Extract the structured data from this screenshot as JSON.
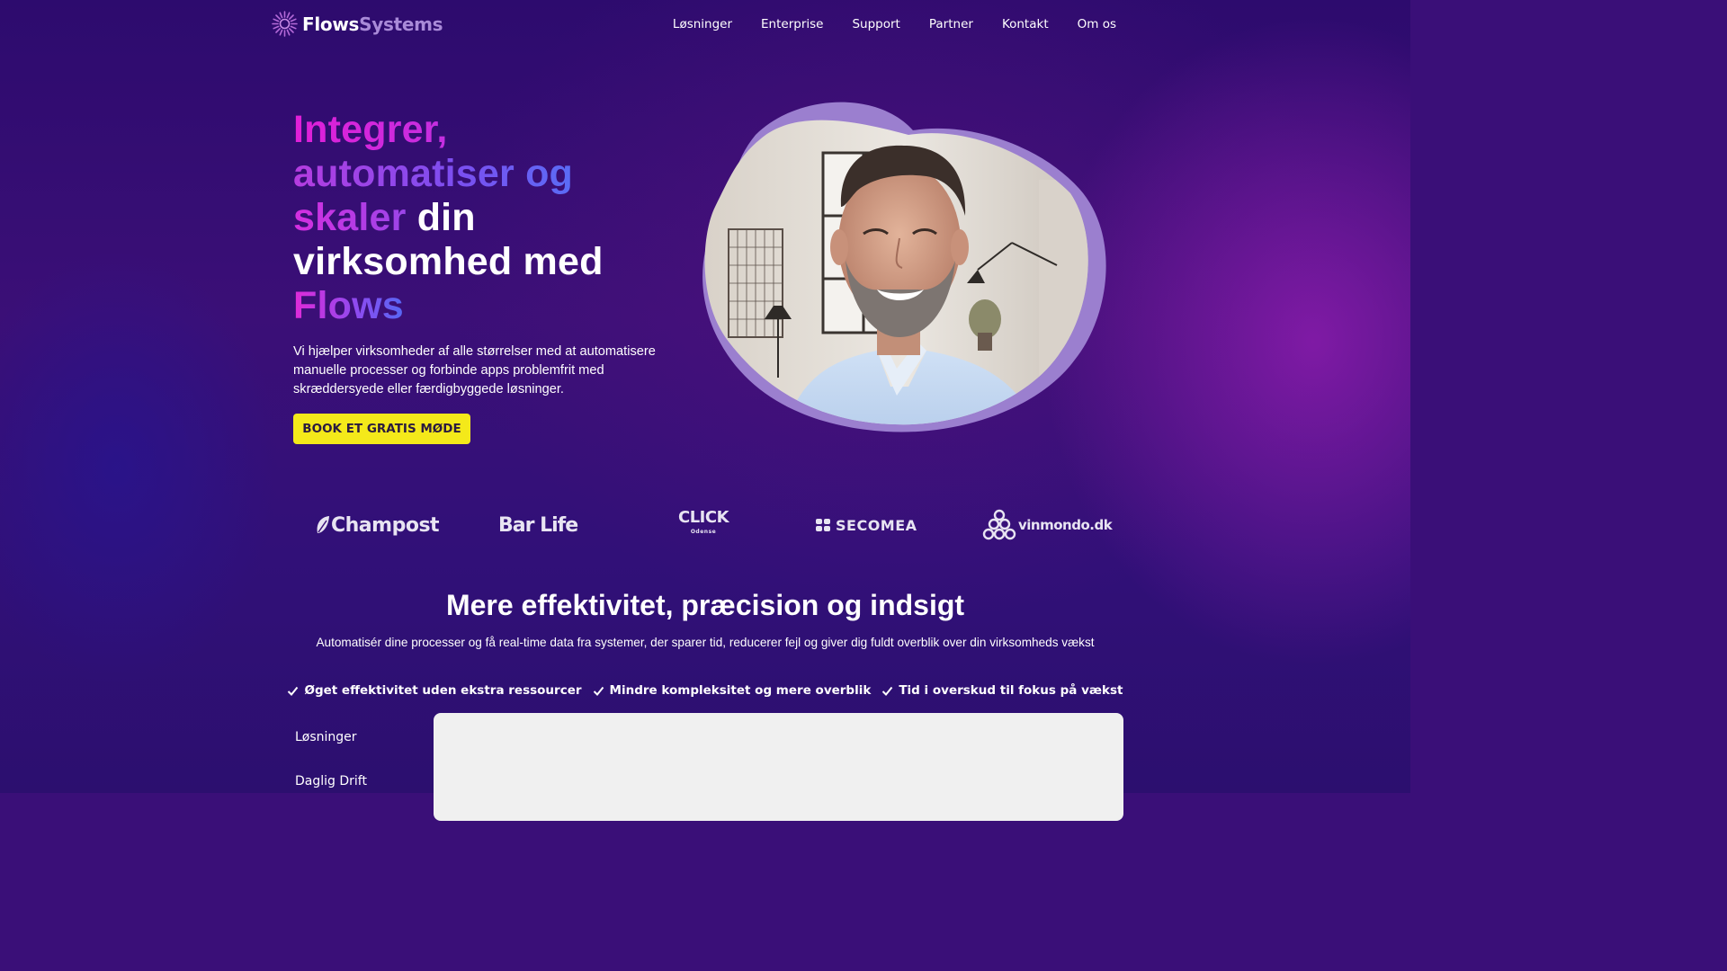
{
  "header": {
    "logo_part1": "Flows",
    "logo_part2": "Systems",
    "nav": [
      "Løsninger",
      "Enterprise",
      "Support",
      "Partner",
      "Kontakt",
      "Om os"
    ]
  },
  "hero": {
    "headline": {
      "w1": "Integrer,",
      "w2": "automatiser og",
      "w3": "skaler",
      "w4": " din",
      "w5": "virksomhed med",
      "w6": "Flows"
    },
    "lead": "Vi hjælper virksomheder af alle størrelser med at automatisere manuelle processer og forbinde apps problemfrit med skræddersyede eller færdigbyggede løsninger.",
    "cta": "BOOK ET GRATIS MØDE"
  },
  "clients": {
    "c1": "Champost",
    "c2": "Bar Life",
    "c3": "CLICK",
    "c3_sub": "Odense",
    "c4": "SECOMEA",
    "c5": "vinmondo.dk"
  },
  "features": {
    "title": "Mere effektivitet, præcision og indsigt",
    "subtitle": "Automatisér dine processer og få real-time data fra systemer, der sparer tid, reducerer fejl og giver dig fuldt overblik over din virksomheds vækst",
    "benefits": [
      "Øget effektivitet uden ekstra ressourcer",
      "Mindre kompleksitet og mere overblik",
      "Tid i overskud til fokus på vækst"
    ],
    "sidebar": [
      "Løsninger",
      "Daglig Drift"
    ]
  },
  "colors": {
    "background": "#3a0f78",
    "cta": "#f4e91a",
    "accent_magenta": "#e01fd8",
    "accent_violet": "#7a4ff0",
    "blob": "#9b7fcf"
  }
}
